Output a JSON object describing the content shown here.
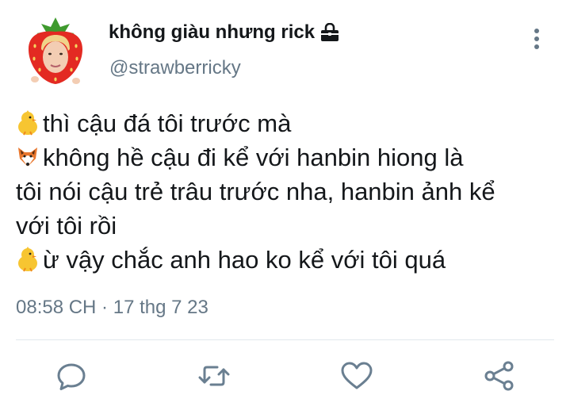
{
  "user": {
    "display_name": "không giàu nhưng rick",
    "handle": "@strawberricky",
    "protected": true
  },
  "tweet": {
    "lines": [
      {
        "emoji": "chick",
        "text": "thì cậu đá tôi trước mà"
      },
      {
        "emoji": "fox",
        "text": "không hề cậu đi kể với hanbin hiong là"
      },
      {
        "emoji": "",
        "text": "tôi nói cậu trẻ trâu trước nha, hanbin ảnh kể"
      },
      {
        "emoji": "",
        "text": "với tôi rồi"
      },
      {
        "emoji": "chick",
        "text": "ừ vậy chắc anh hao ko kể với tôi quá"
      }
    ],
    "timestamp": "08:58 CH · 17 thg 7 23"
  },
  "actions": [
    "reply-icon",
    "retweet-icon",
    "like-icon",
    "share-icon"
  ],
  "colors": {
    "text": "#14171a",
    "secondary": "#657786",
    "divider": "#e1e8ed",
    "icon": "#6a7f91"
  }
}
